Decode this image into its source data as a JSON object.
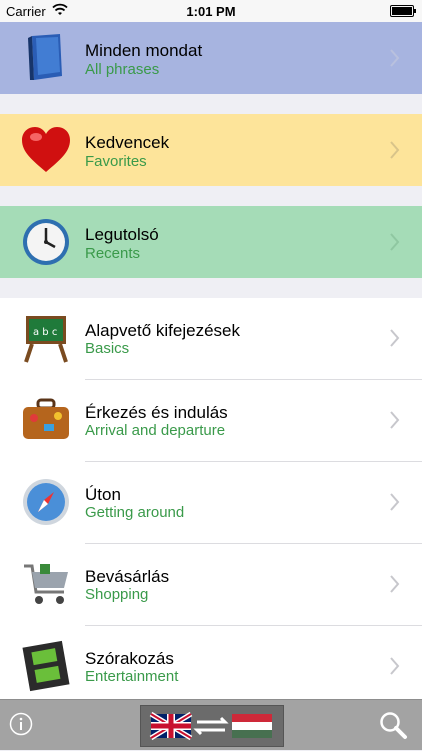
{
  "status_bar": {
    "carrier": "Carrier",
    "time": "1:01 PM"
  },
  "rows": [
    {
      "title": "Minden mondat",
      "subtitle": "All phrases",
      "icon": "book-icon",
      "bg": "#a7b4e0"
    },
    {
      "title": "Kedvencek",
      "subtitle": "Favorites",
      "icon": "heart-icon",
      "bg": "#fde49a"
    },
    {
      "title": "Legutolsó",
      "subtitle": "Recents",
      "icon": "clock-icon",
      "bg": "#a5dcb7"
    },
    {
      "title": "Alapvető kifejezések",
      "subtitle": "Basics",
      "icon": "chalkboard-icon"
    },
    {
      "title": "Érkezés és indulás",
      "subtitle": "Arrival and departure",
      "icon": "suitcase-icon"
    },
    {
      "title": "Úton",
      "subtitle": "Getting around",
      "icon": "compass-icon"
    },
    {
      "title": "Bevásárlás",
      "subtitle": "Shopping",
      "icon": "shopping-cart-icon"
    },
    {
      "title": "Szórakozás",
      "subtitle": "Entertainment",
      "icon": "film-strip-icon"
    }
  ],
  "toolbar": {
    "info_icon": "info-icon",
    "language_pair_icon": "language-switch-icon",
    "search_icon": "search-icon"
  },
  "colors": {
    "subtitle": "#3a9a4a",
    "background": "#efeff4",
    "toolbar": "#a3a3a3"
  }
}
